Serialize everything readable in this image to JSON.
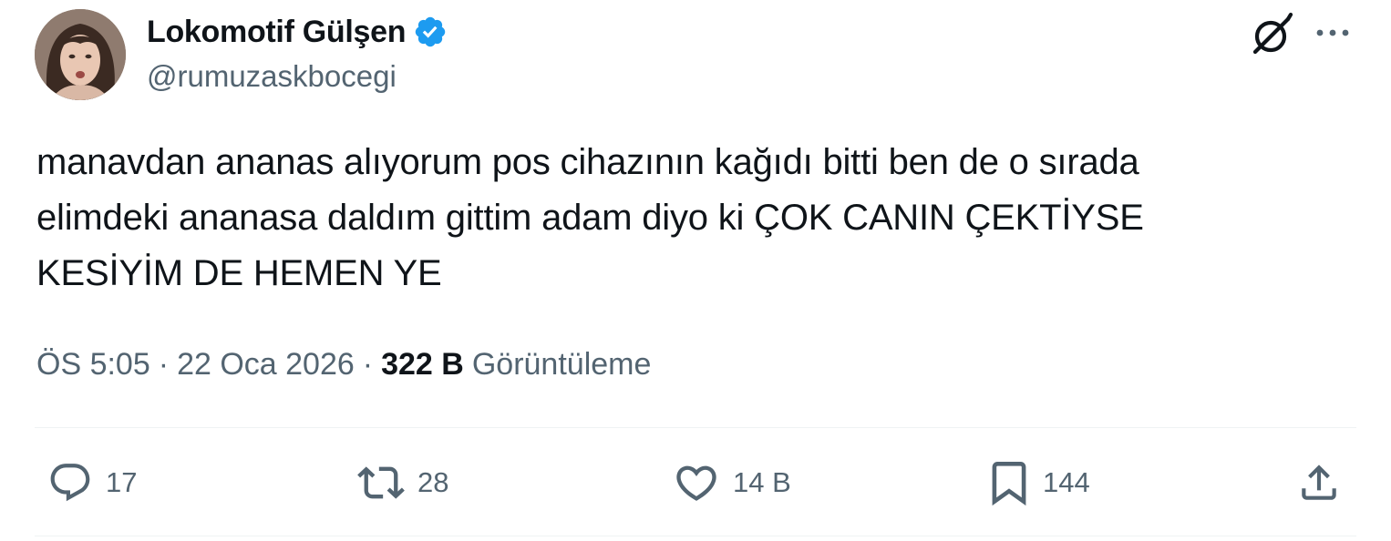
{
  "author": {
    "display_name": "Lokomotif Gülşen",
    "handle": "@rumuzaskbocegi",
    "verified": true,
    "avatar_icon": "profile-photo"
  },
  "header_icons": {
    "grok": "grok-icon",
    "more": "more-horizontal-icon"
  },
  "tweet": {
    "text_lines": [
      "manavdan ananas alıyorum pos cihazının kağıdı bitti ben de o sırada",
      "elimdeki ananasa daldım gittim adam diyo ki ÇOK CANIN ÇEKTİYSE",
      "KESİYİM DE HEMEN YE"
    ]
  },
  "meta": {
    "time": "ÖS 5:05",
    "separator": "·",
    "date": "22 Oca 2026",
    "views_count": "322 B",
    "views_label": "Görüntüleme"
  },
  "actions": {
    "replies": "17",
    "reposts": "28",
    "likes": "14 B",
    "bookmarks": "144"
  },
  "colors": {
    "verified_blue": "#1d9bf0",
    "text_primary": "#0f1419",
    "text_secondary": "#536471",
    "divider": "#eff3f4"
  }
}
